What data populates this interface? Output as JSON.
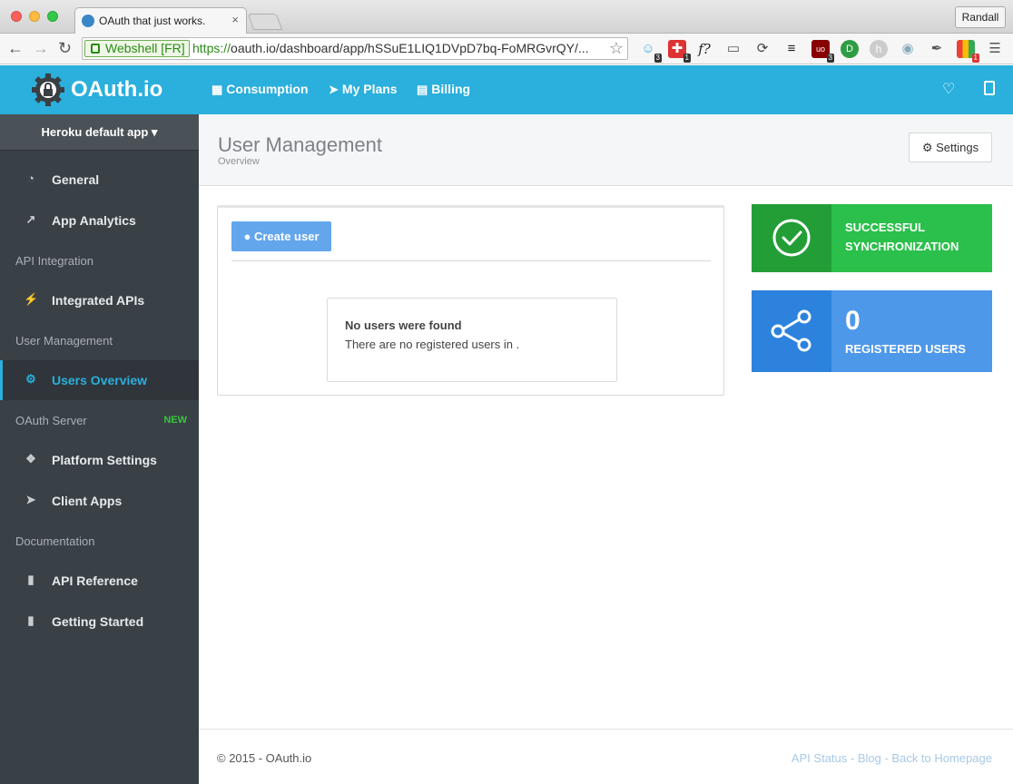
{
  "browser": {
    "tab_title": "OAuth that just works.",
    "tab_close": "×",
    "profile": "Randall",
    "secure_label": "Webshell [FR]",
    "url_scheme": "https://",
    "url_rest": "oauth.io/dashboard/app/hSSuE1LIQ1DVpD7bq-FoMRGvrQY/...",
    "ext_icons": [
      "ghostery-icon",
      "puzzle-icon",
      "fx-icon",
      "cast-icon",
      "sync-icon",
      "buffer-icon",
      "ublock-icon",
      "dashlane-icon",
      "hypothesis-icon",
      "camera-icon",
      "eyedropper-icon",
      "google-icon"
    ],
    "ext_badges": [
      "3",
      "1",
      "3",
      "1"
    ],
    "ext_fx": "f?"
  },
  "header": {
    "logo": "OAuth.io",
    "nav": [
      {
        "label": "Consumption",
        "icon": "bar-chart-icon"
      },
      {
        "label": "My Plans",
        "icon": "rocket-icon"
      },
      {
        "label": "Billing",
        "icon": "credit-card-icon"
      }
    ],
    "right_icons": [
      "bell-icon",
      "panel-icon"
    ],
    "accent": "#2bafdc"
  },
  "sidebar": {
    "app_switcher": "Heroku default app",
    "sections": {
      "api_integration": "API Integration",
      "user_management": "User Management",
      "oauth_server": "OAuth Server",
      "oauth_server_badge": "NEW",
      "documentation": "Documentation"
    },
    "items": {
      "general": "General",
      "app_analytics": "App Analytics",
      "integrated_apis": "Integrated APIs",
      "users_overview": "Users Overview",
      "platform_settings": "Platform Settings",
      "client_apps": "Client Apps",
      "api_reference": "API Reference",
      "getting_started": "Getting Started"
    },
    "active_item": "users_overview"
  },
  "main": {
    "title": "User Management",
    "subtitle": "Overview",
    "settings_button": "Settings",
    "create_user_button": "Create user",
    "empty_title": "No users were found",
    "empty_text": "There are no registered users in ."
  },
  "stats": {
    "sync_line1": "SUCCESSFUL",
    "sync_line2": "SYNCHRONIZATION",
    "users_count": "0",
    "users_label": "REGISTERED USERS",
    "sync_color": "#2bbf4b",
    "users_color": "#4d98e9"
  },
  "footer": {
    "copyright": "© 2015 - OAuth.io",
    "links": [
      "API Status",
      "Blog",
      "Back to Homepage"
    ],
    "separator": " - "
  }
}
